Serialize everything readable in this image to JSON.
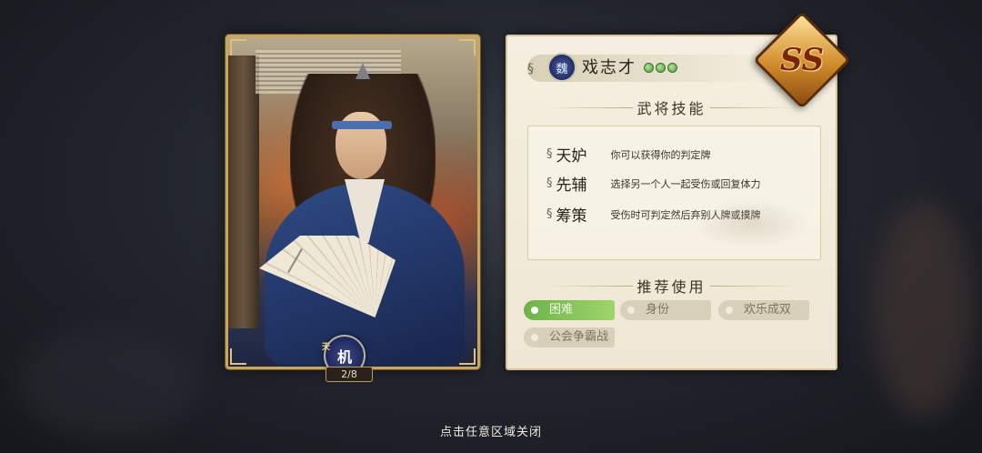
{
  "background": {
    "banner_text": ""
  },
  "hero_card": {
    "rank_emblem_label": "机",
    "rank_emblem_tag": "天",
    "count": "2/8"
  },
  "panel": {
    "faction_icon_label": "魏",
    "hero_name": "戏志才",
    "hp_pips": 3,
    "grade": "SS",
    "skills_title": "武将技能",
    "skills": [
      {
        "name": "天妒",
        "desc": "你可以获得你的判定牌"
      },
      {
        "name": "先辅",
        "desc": "选择另一个人一起受伤或回复体力"
      },
      {
        "name": "筹策",
        "desc": "受伤时可判定然后弃别人牌或摸牌"
      }
    ],
    "recommend_title": "推荐使用",
    "recommend_tags": [
      {
        "label": "困难",
        "active": true
      },
      {
        "label": "身份",
        "active": false
      },
      {
        "label": "欢乐成双",
        "active": false
      },
      {
        "label": "公会争霸战",
        "active": false
      }
    ]
  },
  "close_hint": "点击任意区域关闭",
  "colors": {
    "accent_gold": "#c9a65b",
    "active_tag": "#6fb24a",
    "grade_orange": "#d18b2a"
  }
}
